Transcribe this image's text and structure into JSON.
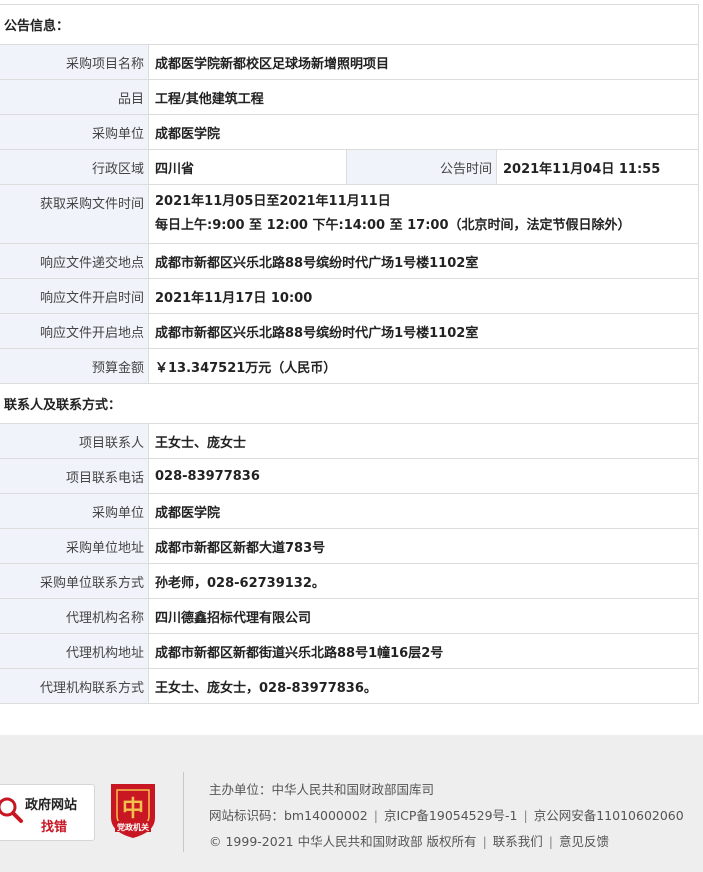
{
  "sections": {
    "announcement_title": "公告信息：",
    "contact_title": "联系人及联系方式："
  },
  "announcement": {
    "project_name_label": "采购项目名称",
    "project_name": "成都医学院新都校区足球场新增照明项目",
    "category_label": "品目",
    "category": "工程/其他建筑工程",
    "purchaser_label": "采购单位",
    "purchaser": "成都医学院",
    "region_label": "行政区域",
    "region": "四川省",
    "publish_time_label": "公告时间",
    "publish_time": "2021年11月04日 11:55",
    "doc_time_label": "获取采购文件时间",
    "doc_time_line1": "2021年11月05日至2021年11月11日",
    "doc_time_line2": "每日上午:9:00 至 12:00  下午:14:00 至 17:00（北京时间，法定节假日除外）",
    "submit_place_label": "响应文件递交地点",
    "submit_place": "成都市新都区兴乐北路88号缤纷时代广场1号楼1102室",
    "open_time_label": "响应文件开启时间",
    "open_time": "2021年11月17日 10:00",
    "open_place_label": "响应文件开启地点",
    "open_place": "成都市新都区兴乐北路88号缤纷时代广场1号楼1102室",
    "budget_label": "预算金额",
    "budget": "￥13.347521万元（人民币）"
  },
  "contacts": {
    "project_contact_label": "项目联系人",
    "project_contact": "王女士、庞女士",
    "project_phone_label": "项目联系电话",
    "project_phone": "028-83977836",
    "purchaser_label": "采购单位",
    "purchaser": "成都医学院",
    "purchaser_address_label": "采购单位地址",
    "purchaser_address": "成都市新都区新都大道783号",
    "purchaser_contact_label": "采购单位联系方式",
    "purchaser_contact": "孙老师，028-62739132。",
    "agency_name_label": "代理机构名称",
    "agency_name": "四川德鑫招标代理有限公司",
    "agency_address_label": "代理机构地址",
    "agency_address": "成都市新都区新都街道兴乐北路88号1幢16层2号",
    "agency_contact_label": "代理机构联系方式",
    "agency_contact": "王女士、庞女士，028-83977836。"
  },
  "footer": {
    "gov_badge_line1": "政府网站",
    "gov_badge_line2": "找错",
    "party_badge_text": "党政机关",
    "host": "主办单位：中华人民共和国财政部国库司",
    "site_id": "网站标识码：bm14000002",
    "icp": "京ICP备19054529号-1",
    "police": "京公网安备11010602060",
    "copyright": "© 1999-2021 中华人民共和国财政部 版权所有",
    "contact_us": "联系我们",
    "feedback": "意见反馈"
  },
  "colors": {
    "label_bg": "#f0f3fa",
    "border": "#dcdcdc",
    "footer_bg": "#eeeeee",
    "badge_red": "#c81623",
    "badge_gold": "#f2c14e"
  }
}
